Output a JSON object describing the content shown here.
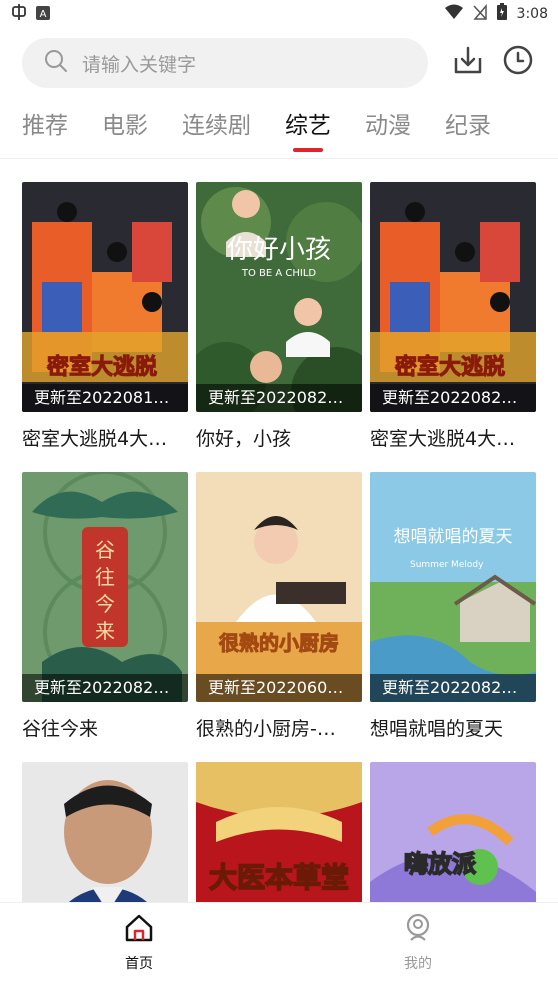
{
  "status_bar": {
    "time": "3:08",
    "left_icons": [
      "app-notification-icon",
      "a-badge-icon"
    ],
    "right_icons": [
      "wifi-icon",
      "no-signal-icon",
      "battery-icon"
    ]
  },
  "search": {
    "placeholder": "请输入关键字"
  },
  "header_actions": [
    "download-icon",
    "history-clock-icon"
  ],
  "tabs": [
    {
      "label": "推荐",
      "active": false
    },
    {
      "label": "电影",
      "active": false
    },
    {
      "label": "连续剧",
      "active": false
    },
    {
      "label": "综艺",
      "active": true
    },
    {
      "label": "动漫",
      "active": false
    },
    {
      "label": "纪录",
      "active": false
    }
  ],
  "items": [
    {
      "title": "密室大逃脱4大…",
      "update": "更新至2022081…",
      "poster_text": "密室大逃脱"
    },
    {
      "title": "你好，小孩",
      "update": "更新至2022082…",
      "poster_text": "你好小孩"
    },
    {
      "title": "密室大逃脱4大…",
      "update": "更新至2022082…",
      "poster_text": "密室大逃脱"
    },
    {
      "title": "谷往今来",
      "update": "更新至2022082…",
      "poster_text": "谷往今来"
    },
    {
      "title": "很熟的小厨房-…",
      "update": "更新至2022060…",
      "poster_text": "很熟的小厨房"
    },
    {
      "title": "想唱就唱的夏天",
      "update": "更新至2022082…",
      "poster_text": "想唱就唱的夏天"
    },
    {
      "title": "",
      "update": "",
      "poster_text": ""
    },
    {
      "title": "",
      "update": "",
      "poster_text": "大医本草堂"
    },
    {
      "title": "",
      "update": "",
      "poster_text": "嗨放派"
    }
  ],
  "bottom_nav": [
    {
      "label": "首页",
      "icon": "home-icon",
      "active": true
    },
    {
      "label": "我的",
      "icon": "profile-icon",
      "active": false
    }
  ],
  "colors": {
    "accent": "#e0242d",
    "active_tab": "#111111",
    "inactive_tab": "#8a8a8a"
  }
}
